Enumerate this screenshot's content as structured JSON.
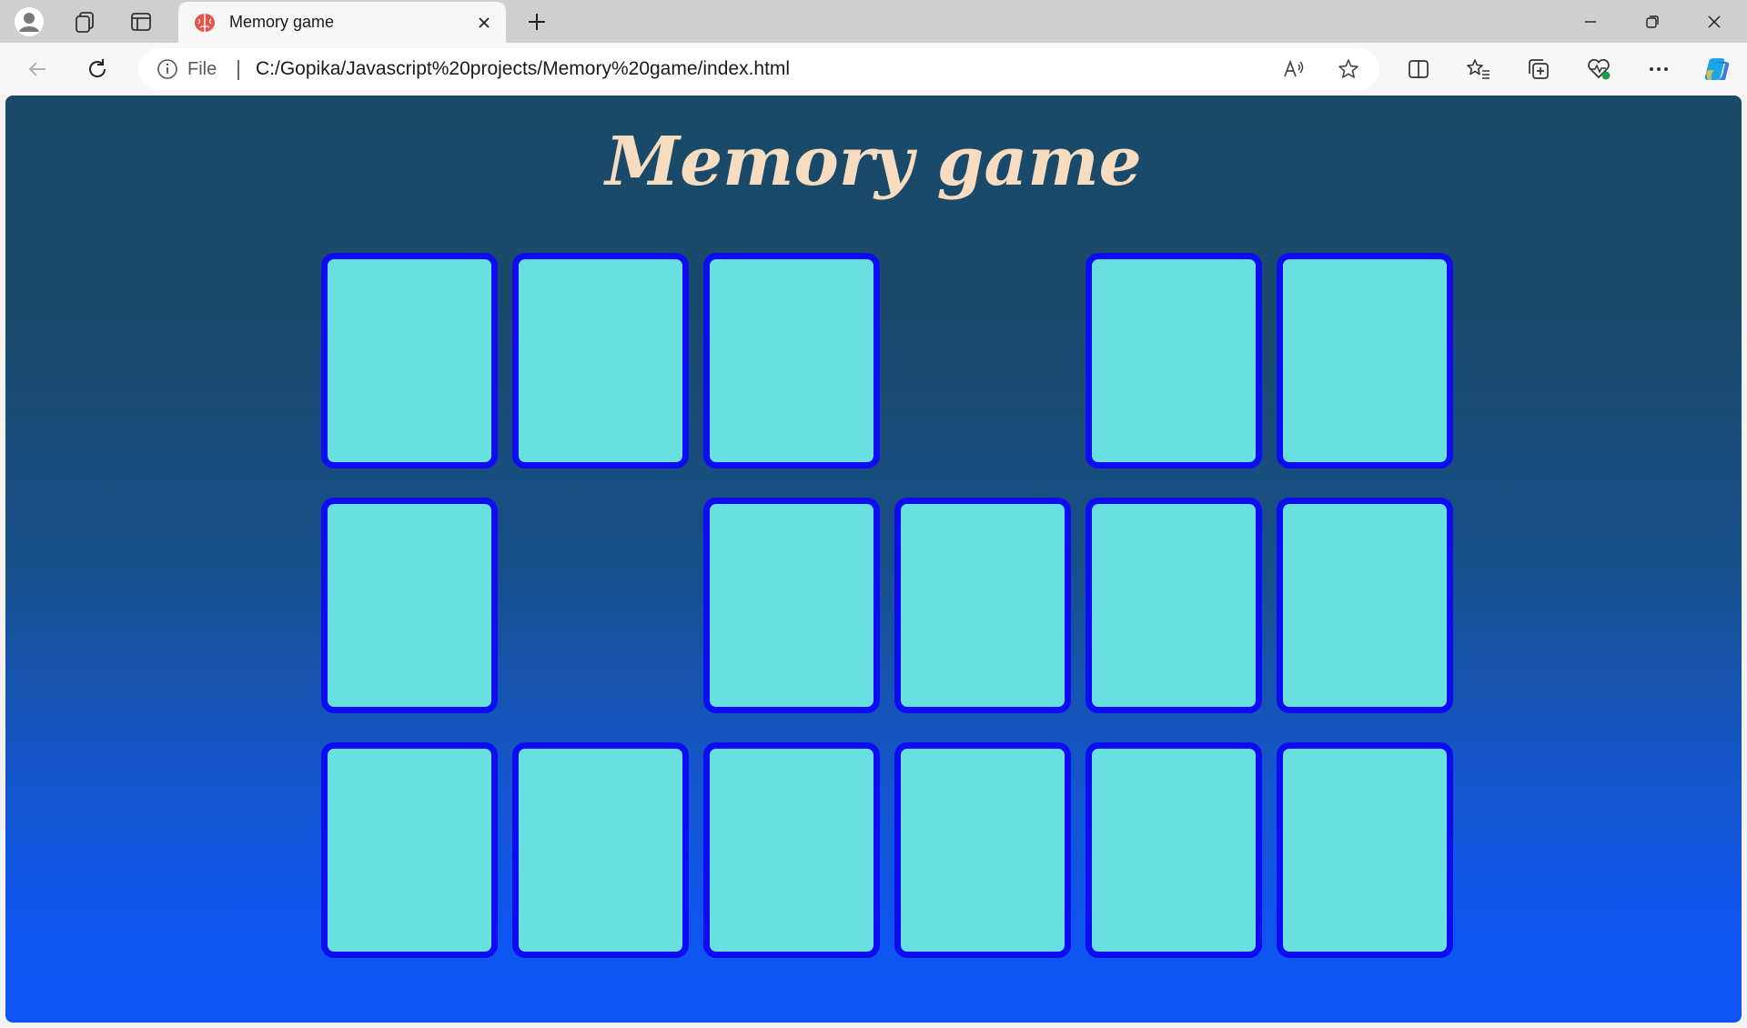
{
  "browser": {
    "tab": {
      "title": "Memory game",
      "icon": "brain-icon"
    },
    "address": {
      "site_label": "File",
      "url": "C:/Gopika/Javascript%20projects/Memory%20game/index.html"
    }
  },
  "page": {
    "title": "Memory game",
    "cards": [
      {
        "state": "face-down"
      },
      {
        "state": "face-down"
      },
      {
        "state": "face-down"
      },
      {
        "state": "matched"
      },
      {
        "state": "face-down"
      },
      {
        "state": "face-down"
      },
      {
        "state": "face-down"
      },
      {
        "state": "matched"
      },
      {
        "state": "face-down"
      },
      {
        "state": "face-down"
      },
      {
        "state": "face-down"
      },
      {
        "state": "face-down"
      },
      {
        "state": "face-down"
      },
      {
        "state": "face-down"
      },
      {
        "state": "face-down"
      },
      {
        "state": "face-down"
      },
      {
        "state": "face-down"
      },
      {
        "state": "face-down"
      }
    ]
  },
  "colors": {
    "card_face": "#67e0df",
    "card_border": "#0d0cf2",
    "title": "#f7dcc0",
    "background_top": "#1a4a68",
    "background_bottom": "#0d55f5"
  }
}
